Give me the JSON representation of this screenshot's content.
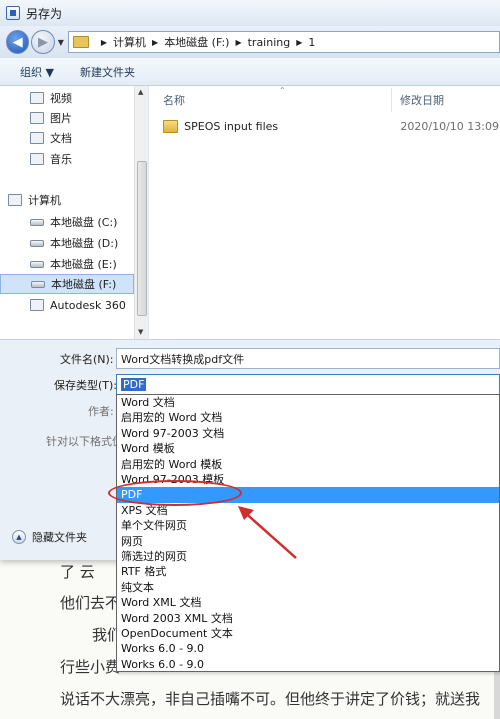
{
  "window": {
    "title": "另存为"
  },
  "address": {
    "crumbs": [
      "计算机",
      "本地磁盘 (F:)",
      "training",
      "1"
    ]
  },
  "toolbar": {
    "organize": "组织 ▼",
    "new_folder": "新建文件夹"
  },
  "nav": {
    "items": [
      {
        "label": "视频",
        "icon": "video-icon"
      },
      {
        "label": "图片",
        "icon": "picture-icon"
      },
      {
        "label": "文档",
        "icon": "document-icon"
      },
      {
        "label": "音乐",
        "icon": "music-icon"
      },
      {
        "label": "计算机",
        "icon": "computer-icon"
      },
      {
        "label": "本地磁盘 (C:)",
        "icon": "drive-icon"
      },
      {
        "label": "本地磁盘 (D:)",
        "icon": "drive-icon"
      },
      {
        "label": "本地磁盘 (E:)",
        "icon": "drive-icon"
      },
      {
        "label": "本地磁盘 (F:)",
        "icon": "drive-icon",
        "selected": true
      },
      {
        "label": "Autodesk 360",
        "icon": "cloud-icon"
      }
    ]
  },
  "files": {
    "columns": [
      "名称",
      "修改日期"
    ],
    "rows": [
      {
        "name": "SPEOS input files",
        "date": "2020/10/10 13:09",
        "icon": "folder-icon"
      }
    ]
  },
  "form": {
    "filename_label": "文件名(N):",
    "filename_value": "Word文档转换成pdf文件",
    "savetype_label": "保存类型(T):",
    "savetype_value": "PDF",
    "author_label": "作者:",
    "optimize_label": "针对以下格式优",
    "hide_folders": "隐藏文件夹"
  },
  "dropdown": {
    "options": [
      "Word 文档",
      "启用宏的 Word 文档",
      "Word 97-2003 文档",
      "Word 模板",
      "启用宏的 Word 模板",
      "Word 97-2003 模板",
      "PDF",
      "XPS 文档",
      "单个文件网页",
      "网页",
      "筛选过的网页",
      "RTF 格式",
      "纯文本",
      "Word XML 文档",
      "Word 2003 XML 文档",
      "OpenDocument 文本",
      "Works 6.0 - 9.0",
      "Works 6.0 - 9.0"
    ],
    "selected": "PDF"
  },
  "background_doc": {
    "lines": [
      "了   云",
      "他们去不",
      "我们",
      "行些小费",
      "说话不大漂亮，非自己插嘴不可。但他终于讲定了价钱；就送我"
    ]
  },
  "colors": {
    "selection": "#3399ff",
    "annotation": "#d42b2b"
  }
}
